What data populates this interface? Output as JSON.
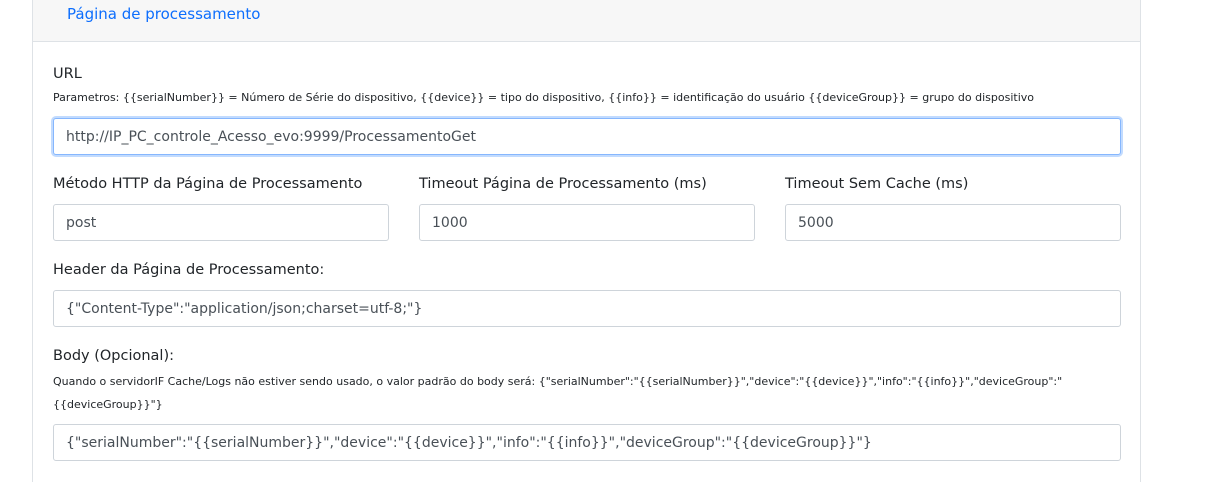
{
  "header": {
    "tab_label": "Página de processamento"
  },
  "url": {
    "label": "URL",
    "help": "Parametros: {{serialNumber}} = Número de Série do dispositivo, {{device}} = tipo do dispositivo, {{info}} = identificação do usuário {{deviceGroup}} = grupo do dispositivo",
    "value": "http://IP_PC_controle_Acesso_evo:9999/ProcessamentoGet"
  },
  "method": {
    "label": "Método HTTP da Página de Processamento",
    "value": "post"
  },
  "timeout": {
    "label": "Timeout Página de Processamento (ms)",
    "value": "1000"
  },
  "timeout_no_cache": {
    "label": "Timeout Sem Cache (ms)",
    "value": "5000"
  },
  "header_field": {
    "label": "Header da Página de Processamento:",
    "value": "{\"Content-Type\":\"application/json;charset=utf-8;\"}"
  },
  "body_field": {
    "label": "Body (Opcional):",
    "help_line1": "Quando o servidorIF Cache/Logs não estiver sendo usado, o valor padrão do body será: {\"serialNumber\":\"{{serialNumber}}\",\"device\":\"{{device}}\",\"info\":\"{{info}}\",\"deviceGroup\":\"",
    "help_line2": "{{deviceGroup}}\"}",
    "value": "{\"serialNumber\":\"{{serialNumber}}\",\"device\":\"{{device}}\",\"info\":\"{{info}}\",\"deviceGroup\":\"{{deviceGroup}}\"}"
  }
}
